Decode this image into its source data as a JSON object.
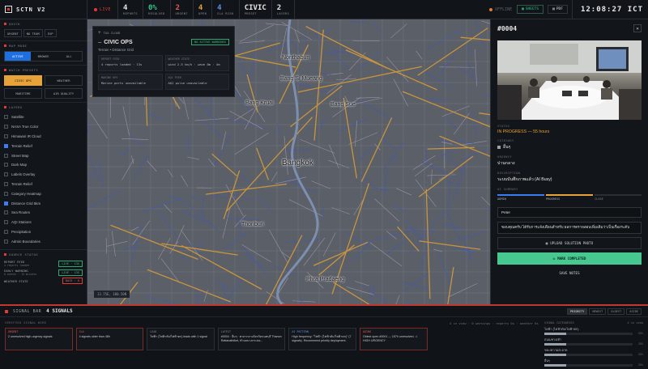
{
  "app": {
    "title": "SCTN V2",
    "live": "LIVE"
  },
  "stats": [
    {
      "value": "4",
      "label": "REPORTS",
      "color": "#e8e8e8"
    },
    {
      "value": "0%",
      "label": "RESOLVED",
      "color": "#38c18b"
    },
    {
      "value": "2",
      "label": "URGENT",
      "color": "#e55a55"
    },
    {
      "value": "4",
      "label": "OPEN",
      "color": "#e8a23a"
    },
    {
      "value": "4",
      "label": "SLA RISK",
      "color": "#5f8ff0"
    },
    {
      "value": "CIVIC",
      "label": "PRESET",
      "color": "#e8e8e8"
    },
    {
      "value": "2",
      "label": "LAYERS",
      "color": "#e8e8e8"
    }
  ],
  "topbar": {
    "offline": "OFFLINE",
    "sheets": "SHEETS",
    "pdf": "PDF",
    "clock": "12:08:27 ICT"
  },
  "sidebar": {
    "quick": {
      "title": "QUICK",
      "chips": [
        "URGENT",
        "NO TEAM",
        "EXP"
      ]
    },
    "mapmode": {
      "title": "MAP MODE",
      "items": [
        "ACTIVE",
        "BROWSE",
        "ALL"
      ],
      "active": 0
    },
    "presets": {
      "title": "WATCH PRESETS",
      "items": [
        "CIVIC OPS",
        "WEATHER",
        "MARITIME",
        "AIR QUALITY"
      ],
      "active": 0
    },
    "layers": {
      "title": "LAYERS",
      "items": [
        {
          "label": "Satellite",
          "on": false
        },
        {
          "label": "NASA True Color",
          "on": false
        },
        {
          "label": "Himawari IR Cloud",
          "on": false
        },
        {
          "label": "Terrain Relief",
          "on": true
        },
        {
          "label": "Street Map",
          "on": false
        },
        {
          "label": "Dark Map",
          "on": false
        },
        {
          "label": "Labels Overlay",
          "on": false
        },
        {
          "label": "Terrain Relief",
          "on": false
        },
        {
          "label": "Category Heatmap",
          "on": false
        },
        {
          "label": "Distance Grid 5km",
          "on": true
        },
        {
          "label": "Sea Routes",
          "on": false
        },
        {
          "label": "AQI Stations",
          "on": false
        },
        {
          "label": "Precipitation",
          "on": false
        },
        {
          "label": "Admin Boundaries",
          "on": false
        }
      ]
    },
    "source": {
      "title": "SOURCE STATUS",
      "rows": [
        {
          "name": "REPORT FEED",
          "sub": "4 reports loaded",
          "badge": "LIVE · 13S",
          "tone": "green"
        },
        {
          "name": "EARLY WARNING",
          "sub": "0 events · 15 minutes",
          "badge": "LIVE · 13S",
          "tone": "green"
        },
        {
          "name": "WEATHER STATE",
          "sub": "",
          "badge": "BACK · 0",
          "tone": "red"
        }
      ]
    }
  },
  "map": {
    "labels": [
      "Nonthaburi",
      "Bang Si Mueang",
      "Bang Kruai",
      "Bang Sue",
      "Bangkok",
      "Phra Pradaeng",
      "Thonburi"
    ],
    "scale": "13.75E, 100.50N"
  },
  "overlay": {
    "toggle": "TOA CLOUD",
    "title": "CIVIC OPS",
    "badge": "NO ACTIVE WARNINGS",
    "subtitle": "Terrain • Distance Grid",
    "cells": [
      {
        "t": "REPORT FEED",
        "d": "4 reports loaded · 13s"
      },
      {
        "t": "WEATHER STATE",
        "d": "wind 2.5 km/h · wave 0m · 4m"
      },
      {
        "t": "MARINE OPS",
        "d": "Marine ports unavailable"
      },
      {
        "t": "AQI FEED",
        "d": "AQI pulse unavailable"
      }
    ]
  },
  "panel": {
    "id": "#0004",
    "status_label": "STATUS",
    "status": "IN PROGRESS — 55 hours",
    "category_label": "CATEGORY",
    "category": "อื่นๆ",
    "urgency_label": "URGENCY",
    "urgency": "ปานกลาง",
    "desc_label": "DESCRIPTION",
    "desc": "ระบบบันทึกภาพแล้ว (AI Busy)",
    "ai_label": "AI SUMMARY",
    "phases": [
      "ADMIN",
      "PROGRESS",
      "CLOSE"
    ],
    "name": "Peter",
    "note": "ขอบคุณครับ ได้รับการแจ้งเตือนสำหรับ ผลการตรวจสอบเพิ่มเติมว่าเป็นเรื่องระดับ",
    "upload": "UPLOAD SOLUTION PHOTO",
    "complete": "MARK COMPLETED",
    "save": "SAVE NOTES"
  },
  "bottom": {
    "title": "SIGNAL BAR",
    "count": "4 SIGNALS",
    "subtitle": "VERIFIED SIGNAL WIRE",
    "meta": "4 in view · 0 warnings · reports 0s · weather 0s",
    "tabs": [
      "PRIORITY",
      "NEWEST",
      "OLDEST",
      "ASIDE"
    ],
    "active_tab": 0,
    "cards": [
      {
        "t": "URGENT",
        "d": "2 unresolved high-urgency signals",
        "tone": "red"
      },
      {
        "t": "SLA",
        "d": "4 signals older than 48h",
        "tone": "red"
      },
      {
        "t": "LEAD",
        "d": "ไฟฟ้า (ไฟฟ้าดับ/ไฟฟ้าตก) leads with 1 signal",
        "tone": ""
      },
      {
        "t": "LATEST",
        "d": "#0004 · อื่นๆ · ศาลากลางจังหวัดนนทบุรี Thanon Rattanathibet, ตำบลบางกระสอ...",
        "tone": ""
      },
      {
        "t": "AI PATTERN",
        "d": "High frequency: \"ไฟฟ้า (ไฟฟ้าดับ/ไฟฟ้าตก)\" (7 signals). Recommend priority deployment.",
        "tone": "blue"
      },
      {
        "t": "AGING",
        "d": "Oldest open #0001 — 157h unresolved. ⚠ HIGH URGENCY",
        "tone": "red"
      }
    ],
    "sigcats": {
      "title": "SIGNAL CATEGORIES",
      "meta": "4 in view",
      "rows": [
        {
          "name": "ไฟฟ้า (ไฟฟ้าดับ/ไฟฟ้าตก)",
          "pct": 0.25
        },
        {
          "name": "ถนน/ทางเท้า",
          "pct": 0.25
        },
        {
          "name": "ขยะ/ความสะอาด",
          "pct": 0.25
        },
        {
          "name": "อื่นๆ",
          "pct": 0.25
        }
      ]
    }
  }
}
